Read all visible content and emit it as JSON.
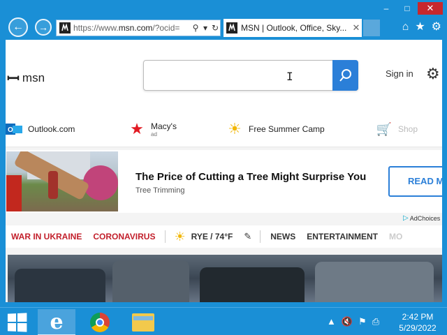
{
  "browser": {
    "window_controls": [
      "–",
      "□",
      "✕"
    ],
    "address": {
      "url_prefix": "https://www.",
      "url_host": "msn.com",
      "url_suffix": "/?ocid="
    },
    "tab": {
      "title": "MSN | Outlook, Office, Sky...",
      "close": "✕"
    },
    "right_icons": [
      "⌂",
      "★",
      "⚙"
    ]
  },
  "header": {
    "logo_text": "msn",
    "search": {
      "value": "",
      "placeholder": ""
    },
    "signin_label": "Sign in"
  },
  "quick_links": [
    {
      "label": "Outlook.com",
      "sub": "",
      "icon": "outlook-icon"
    },
    {
      "label": "Macy's",
      "sub": "ad",
      "icon": "macys-star-icon"
    },
    {
      "label": "Free Summer Camp",
      "sub": "",
      "icon": "sun-icon"
    },
    {
      "label": "Shop",
      "sub": "",
      "icon": "cart-icon"
    }
  ],
  "ad": {
    "title": "The Price of Cutting a Tree Might Surprise You",
    "source": "Tree Trimming",
    "button": "READ M",
    "adchoices": "AdChoices"
  },
  "topics": {
    "items": [
      "WAR IN UKRAINE",
      "CORONAVIRUS"
    ],
    "weather": "RYE / 74°F",
    "sections": [
      "NEWS",
      "ENTERTAINMENT",
      "MO"
    ]
  },
  "taskbar": {
    "time": "2:42 PM",
    "date": "5/29/2022"
  },
  "colors": {
    "accent": "#1a8fd6",
    "search_button": "#2b7fd8",
    "topic_red": "#c21f2b"
  }
}
